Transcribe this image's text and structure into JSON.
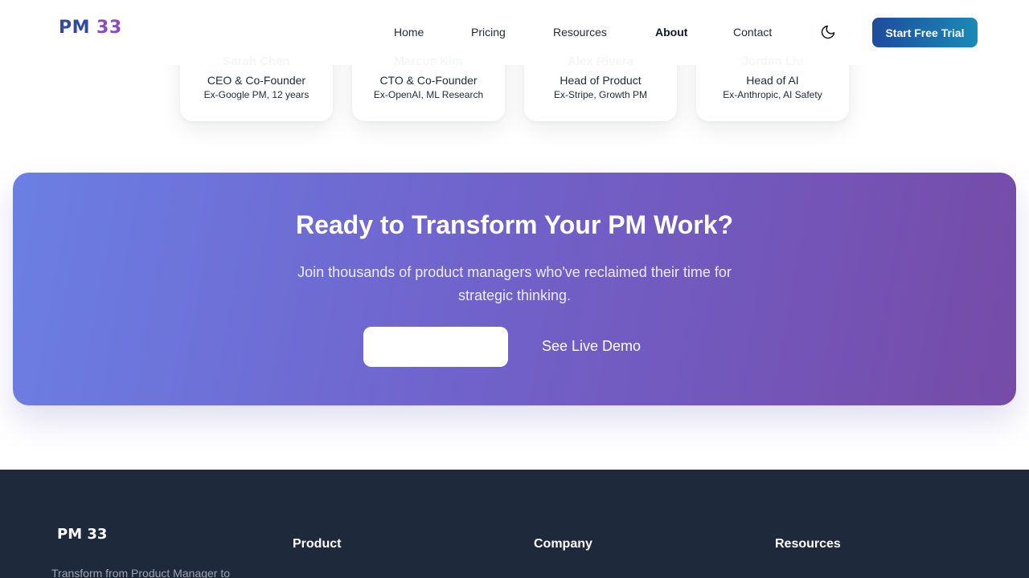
{
  "header": {
    "logo": {
      "pm": "PM",
      "num": "33"
    },
    "nav": [
      "Home",
      "Pricing",
      "Resources",
      "About",
      "Contact"
    ],
    "active_nav": "About",
    "cta_label": "Start Free Trial",
    "theme_icon": "moon-icon"
  },
  "team": [
    {
      "name": "Sarah Chen",
      "role": "CEO & Co-Founder",
      "background": "Ex-Google PM, 12 years"
    },
    {
      "name": "Marcus Kim",
      "role": "CTO & Co-Founder",
      "background": "Ex-OpenAI, ML Research"
    },
    {
      "name": "Alex Rivera",
      "role": "Head of Product",
      "background": "Ex-Stripe, Growth PM"
    },
    {
      "name": "Jordan Liu",
      "role": "Head of AI",
      "background": "Ex-Anthropic, AI Safety"
    }
  ],
  "banner": {
    "title": "Ready to Transform Your PM Work?",
    "subtitle": "Join thousands of product managers who've reclaimed their time for strategic thinking.",
    "primary_label": "",
    "secondary_label": "See Live Demo"
  },
  "footer": {
    "logo": "PM 33",
    "tagline": "Transform from Product Manager to",
    "columns": [
      "Product",
      "Company",
      "Resources"
    ]
  },
  "colors": {
    "brand_blue": "#1e4b9c",
    "brand_teal": "#1a8bb5",
    "banner_start": "#6b7fe3",
    "banner_end": "#764ba8",
    "footer_bg": "#1e293b"
  }
}
